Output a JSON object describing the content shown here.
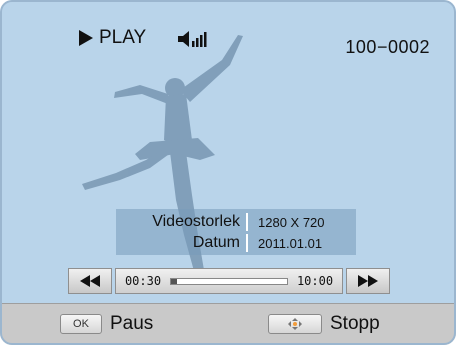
{
  "status": {
    "play_label": "PLAY",
    "file_number": "100−0002"
  },
  "info": {
    "size_label": "Videostorlek",
    "size_value": "1280 X 720",
    "date_label": "Datum",
    "date_value": "2011.01.01"
  },
  "player": {
    "current_time": "00:30",
    "total_time": "10:00",
    "progress_fraction": 0.05
  },
  "softkeys": {
    "ok_key": "OK",
    "pause_label": "Paus",
    "stop_label": "Stopp"
  },
  "icons": {
    "play": "play-icon",
    "volume": "volume-icon",
    "rewind": "rewind-icon",
    "fast_forward": "fast-forward-icon",
    "dpad": "dpad-icon"
  },
  "colors": {
    "screen_bg": "#b9d4ea",
    "silhouette": "#7c9ab5",
    "info_panel": "#789bb9",
    "bottom_bar": "#c9c9c9"
  }
}
